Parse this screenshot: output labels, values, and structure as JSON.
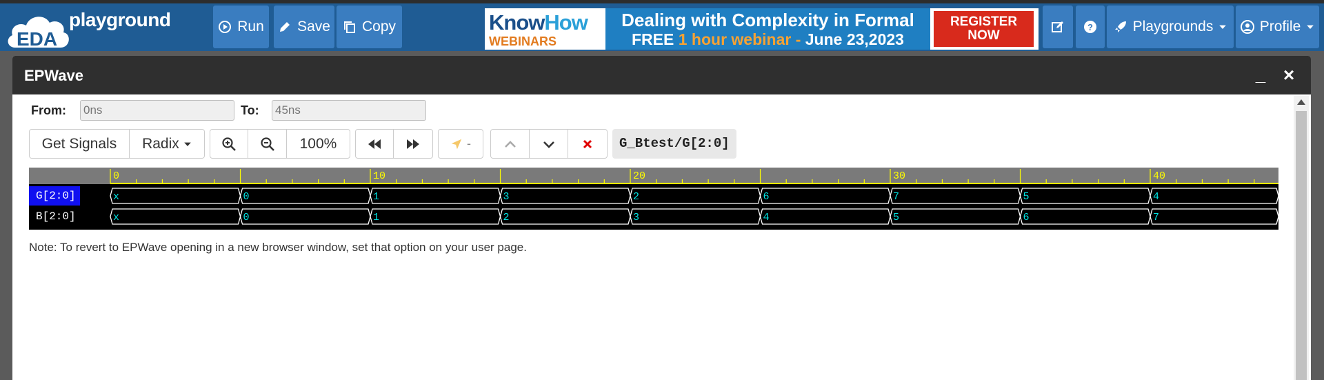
{
  "header": {
    "logo_text": "EDA",
    "app_name": "playground",
    "run_label": "Run",
    "save_label": "Save",
    "copy_label": "Copy",
    "playgrounds_label": "Playgrounds",
    "profile_label": "Profile"
  },
  "banner": {
    "brand_a": "Know",
    "brand_b": "How",
    "brand_sub": "WEBINARS",
    "line1": "Dealing with Complexity in Formal",
    "line2_a": "FREE",
    "line2_b": "1 hour webinar -",
    "line2_c": "June 23,2023",
    "cta_line1": "REGISTER",
    "cta_line2": "NOW"
  },
  "modal": {
    "title": "EPWave",
    "from_label": "From:",
    "from_value": "0ns",
    "to_label": "To:",
    "to_value": "45ns",
    "get_signals": "Get Signals",
    "radix": "Radix",
    "zoom": "100%",
    "cursor_label": "-",
    "signal_path": "G_Btest/G[2:0]",
    "note": "Note: To revert to EPWave opening in a new browser window, set that option on your user page."
  },
  "waveform": {
    "ruler_labels": [
      "0",
      "10",
      "20",
      "30",
      "40"
    ],
    "signals": [
      {
        "name": "G[2:0]",
        "selected": true,
        "values": [
          "x",
          "0",
          "1",
          "3",
          "2",
          "6",
          "7",
          "5",
          "4"
        ]
      },
      {
        "name": "B[2:0]",
        "selected": false,
        "values": [
          "x",
          "0",
          "1",
          "2",
          "3",
          "4",
          "5",
          "6",
          "7"
        ]
      }
    ],
    "colors": {
      "ruler_text": "#ffff00",
      "value_text": "#00e5e5",
      "trace": "#ffffff",
      "selected_bg": "#1010f0"
    }
  }
}
